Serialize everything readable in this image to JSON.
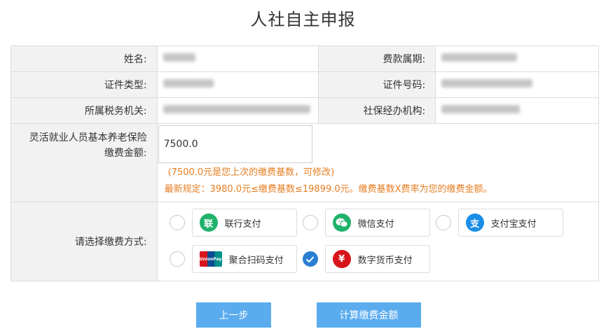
{
  "page": {
    "title": "人社自主申报"
  },
  "form": {
    "name_label": "姓名:",
    "period_label": "费款属期:",
    "id_type_label": "证件类型:",
    "id_no_label": "证件号码:",
    "tax_office_label": "所属税务机关:",
    "agency_label": "社保经办机构:",
    "amount_label": "灵活就业人员基本养老保险缴费金额:",
    "amount_value": "7500.0",
    "hint_1": "(7500.0元是您上次的缴费基数，可修改)",
    "hint_2": "最新规定：3980.0元≤缴费基数≤19899.0元。缴费基数X费率为您的缴费金额。",
    "pay_method_label": "请选择缴费方式:"
  },
  "payment_methods": [
    {
      "label": "联行支付",
      "icon": "联",
      "icon_name": "lianhang-icon",
      "color": "#20b26b",
      "checked": false
    },
    {
      "label": "微信支付",
      "icon": "wechat",
      "icon_name": "wechat-icon",
      "color": "#20b26b",
      "checked": false
    },
    {
      "label": "支付宝支付",
      "icon": "支",
      "icon_name": "alipay-icon",
      "color": "#1a8ee6",
      "checked": false
    },
    {
      "label": "聚合扫码支付",
      "icon": "UnionPay",
      "icon_name": "unionpay-icon",
      "color": "#d7141a",
      "checked": false
    },
    {
      "label": "数字货币支付",
      "icon": "¥",
      "icon_name": "digital-currency-icon",
      "color": "#d7141a",
      "checked": true
    }
  ],
  "buttons": {
    "prev": "上一步",
    "calc": "计算缴费金额"
  },
  "colors": {
    "accent": "#5aacee",
    "hint": "#e67e22",
    "checked": "#2b7fd2"
  }
}
